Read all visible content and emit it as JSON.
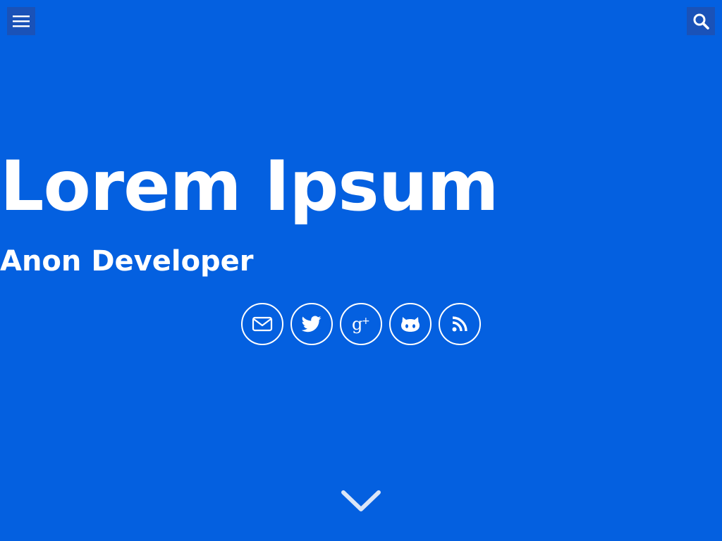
{
  "header": {
    "menu_icon": "hamburger-menu-icon",
    "search_icon": "search-icon"
  },
  "hero": {
    "title": "Lorem Ipsum",
    "subtitle": "Anon Developer"
  },
  "social": [
    {
      "name": "email",
      "icon": "envelope-icon"
    },
    {
      "name": "twitter",
      "icon": "twitter-bird-icon"
    },
    {
      "name": "google-plus",
      "icon": "google-plus-icon"
    },
    {
      "name": "github",
      "icon": "github-octocat-icon"
    },
    {
      "name": "rss",
      "icon": "rss-feed-icon"
    }
  ],
  "scroll": {
    "icon": "chevron-down-icon"
  },
  "colors": {
    "background": "#0460e0",
    "button_bg": "#1a52b8",
    "foreground": "#ffffff"
  }
}
